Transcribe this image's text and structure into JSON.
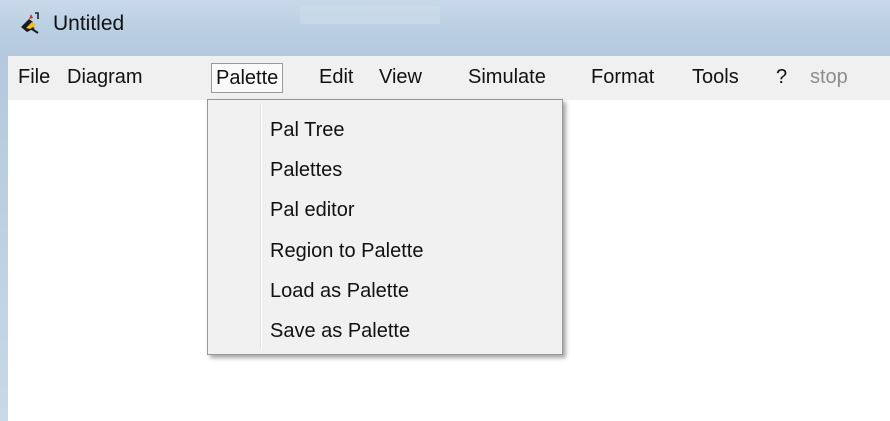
{
  "window": {
    "title": "Untitled",
    "app_icon": "scilab-bird-icon"
  },
  "menubar": {
    "items": [
      {
        "label": "File"
      },
      {
        "label": "Diagram"
      },
      {
        "label": "Palette"
      },
      {
        "label": "Edit"
      },
      {
        "label": "View"
      },
      {
        "label": "Simulate"
      },
      {
        "label": "Format"
      },
      {
        "label": "Tools"
      },
      {
        "label": "?"
      },
      {
        "label": "stop"
      }
    ],
    "active": "Palette"
  },
  "palette_menu": {
    "items": [
      {
        "label": "Pal Tree"
      },
      {
        "label": "Palettes"
      },
      {
        "label": "Pal editor"
      },
      {
        "label": "Region to Palette"
      },
      {
        "label": "Load as Palette"
      },
      {
        "label": "Save as Palette"
      }
    ]
  },
  "colors": {
    "titlebar": "#bcd0e4",
    "menubar": "#f0f0f0",
    "menu_bg": "#f1f1f1",
    "disabled_text": "#8e8e8e"
  }
}
